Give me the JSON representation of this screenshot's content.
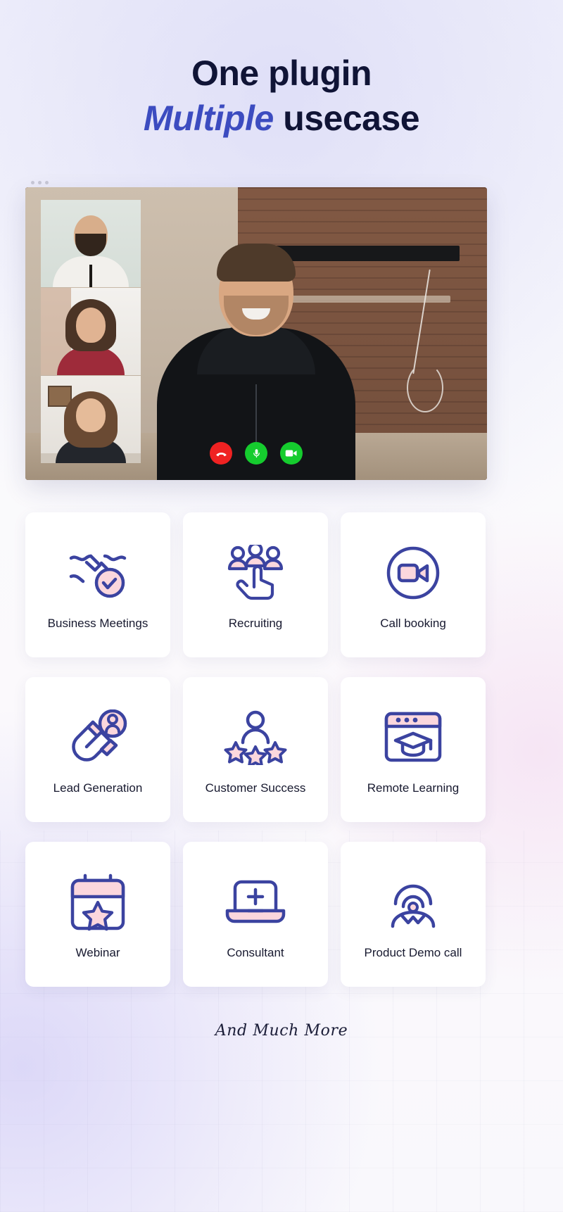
{
  "heading": {
    "line1": "One plugin",
    "line2_accent": "Multiple",
    "line2_rest": " usecase"
  },
  "video_panel": {
    "window_dots": 3,
    "controls": [
      {
        "name": "hang-up",
        "label": "End call",
        "color": "#ef2222"
      },
      {
        "name": "microphone",
        "label": "Mute microphone",
        "color": "#15cc2e"
      },
      {
        "name": "camera",
        "label": "Toggle camera",
        "color": "#15cc2e"
      }
    ],
    "participants": [
      {
        "label": "Participant 1"
      },
      {
        "label": "Participant 2"
      },
      {
        "label": "Participant 3"
      },
      {
        "label": "Main speaker"
      }
    ]
  },
  "cards": [
    {
      "label": "Business Meetings",
      "icon": "handshake-check-icon"
    },
    {
      "label": "Recruiting",
      "icon": "people-pointer-icon"
    },
    {
      "label": "Call booking",
      "icon": "video-camera-circle-icon"
    },
    {
      "label": "Lead Generation",
      "icon": "magnet-person-icon"
    },
    {
      "label": "Customer Success",
      "icon": "person-stars-icon"
    },
    {
      "label": "Remote Learning",
      "icon": "browser-graduation-cap-icon"
    },
    {
      "label": "Webinar",
      "icon": "calendar-star-icon"
    },
    {
      "label": "Consultant",
      "icon": "laptop-plus-icon"
    },
    {
      "label": "Product Demo call",
      "icon": "person-signal-icon"
    }
  ],
  "footer": {
    "note": "And Much More"
  },
  "colors": {
    "accent_blue": "#3c4cc0",
    "icon_stroke": "#3b43a0",
    "icon_fill_pink": "#fbd7dd",
    "heading_dark": "#101436",
    "card_bg": "#ffffff"
  }
}
